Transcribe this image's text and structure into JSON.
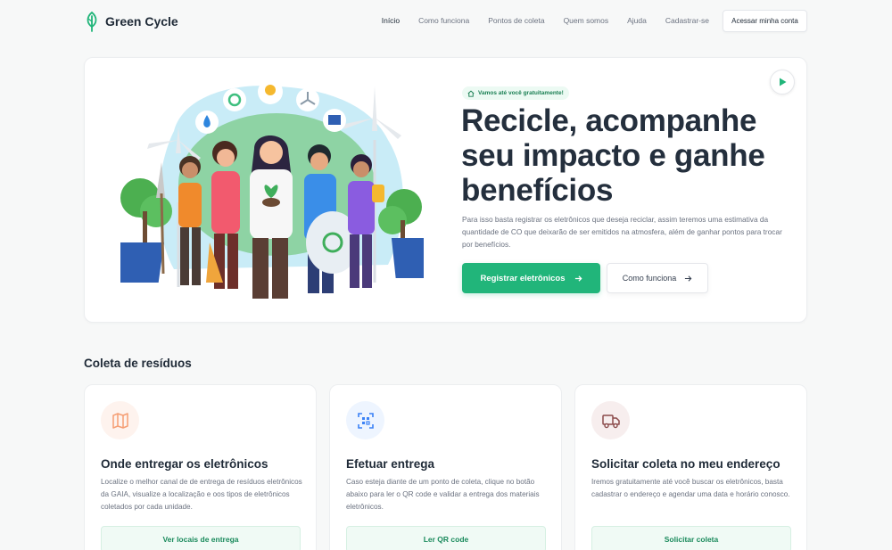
{
  "brand": {
    "name": "Green Cycle",
    "accent": "#21b57a"
  },
  "nav": {
    "links": [
      "Início",
      "Como funciona",
      "Pontos de coleta",
      "Quem somos",
      "Ajuda",
      "Cadastrar-se"
    ],
    "active": "Início",
    "account_button": "Acessar minha conta"
  },
  "hero": {
    "badge": "Vamos até você gratuitamente!",
    "badge_icon": "home-icon",
    "title": "Recicle, acompanhe seu impacto e ganhe benefícios",
    "description": "Para isso basta registrar os eletrônicos que deseja reciclar, assim teremos uma estimativa da quantidade de CO que deixarão de ser emitidos na atmosfera, além de ganhar pontos para trocar por benefícios.",
    "primary_button": "Registrar eletrônicos",
    "secondary_button": "Como funciona",
    "play_icon": "play-icon"
  },
  "section": {
    "title": "Coleta de resíduos",
    "cards": [
      {
        "icon": "map-icon",
        "icon_color": "#f59e74",
        "icon_bg": "#fef3ee",
        "title": "Onde entregar os eletrônicos",
        "description": "Localize o melhor canal de de entrega de resíduos eletrônicos da GAIA, visualize a localização e oos tipos de eletrônicos coletados por cada unidade.",
        "button": "Ver locais de entrega"
      },
      {
        "icon": "qr-scan-icon",
        "icon_color": "#3b82f6",
        "icon_bg": "#eef5ff",
        "title": "Efetuar entrega",
        "description": "Caso esteja diante de um ponto de coleta, clique no botão abaixo para ler o QR code e validar a entrega dos materiais eletrônicos.",
        "button": "Ler QR code"
      },
      {
        "icon": "truck-icon",
        "icon_color": "#8b4a4a",
        "icon_bg": "#f7eeee",
        "title": "Solicitar coleta no meu endereço",
        "description": "Iremos gratuitamente até você buscar os eletrônicos, basta cadastrar o endereço e agendar uma data e horário conosco.",
        "button": "Solicitar coleta"
      }
    ]
  }
}
